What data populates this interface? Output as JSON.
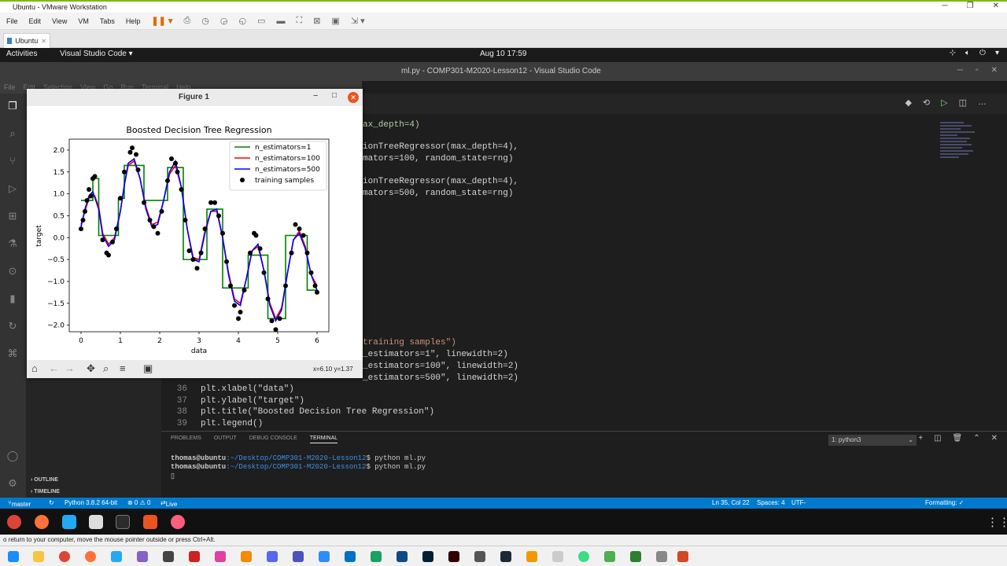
{
  "vmware": {
    "title": "Ubuntu - VMware Workstation",
    "menu": [
      "File",
      "Edit",
      "View",
      "VM",
      "Tabs",
      "Help"
    ],
    "tab_label": "Ubuntu",
    "hint": "o return to your computer, move the mouse pointer outside or press Ctrl+Alt."
  },
  "gnome": {
    "activities": "Activities",
    "app_label": "Visual Studio Code",
    "clock": "Aug 10  17:59"
  },
  "vscode": {
    "window_title": "ml.py - COMP301-M2020-Lesson12 - Visual Studio Code",
    "menu": [
      "File",
      "Edit",
      "Selection",
      "View",
      "Go",
      "Run",
      "Terminal",
      "Help"
    ],
    "sidebar_outline": "OUTLINE",
    "sidebar_timeline": "TIMELINE",
    "code_partial": [
      "ax_depth=4)",
      "ionTreeRegressor(max_depth=4),",
      "mators=100, random_state=rng)",
      "ionTreeRegressor(max_depth=4),",
      "mators=500, random_state=rng)",
      "training samples\")",
      "_estimators=1\", linewidth=2)",
      "_estimators=100\", linewidth=2)",
      "_estimators=500\", linewidth=2)"
    ],
    "code_lines": [
      {
        "num": "36",
        "text": "plt.xlabel(\"data\")"
      },
      {
        "num": "37",
        "text": "plt.ylabel(\"target\")"
      },
      {
        "num": "38",
        "text": "plt.title(\"Boosted Decision Tree Regression\")"
      },
      {
        "num": "39",
        "text": "plt.legend()"
      }
    ],
    "panel_tabs": [
      "PROBLEMS",
      "OUTPUT",
      "DEBUG CONSOLE",
      "TERMINAL"
    ],
    "terminal_select": "1: python3",
    "terminal_lines": [
      {
        "user": "thomas@ubuntu",
        "path": ":~/Desktop/COMP301-M2020-Lesson12",
        "cmd": "$ python ml.py"
      },
      {
        "user": "thomas@ubuntu",
        "path": ":~/Desktop/COMP301-M2020-Lesson12",
        "cmd": "$ python ml.py"
      }
    ],
    "status": {
      "branch": "master",
      "python": "Python 3.8.2 64-bit",
      "problems": "⊗ 0 ⚠ 0",
      "liveshare": "Live Share",
      "position": "Ln 35, Col 22",
      "spaces": "Spaces: 4",
      "encoding": "UTF-",
      "formatting": "Formatting: ✓"
    }
  },
  "figure": {
    "window_title": "Figure 1",
    "coord_readout": "x=6.10 y=1.37",
    "colors": {
      "n1": "#008000",
      "n100": "#ff0000",
      "n500": "#0000ff",
      "samples": "#000000"
    }
  },
  "chart_data": {
    "type": "line",
    "title": "Boosted Decision Tree Regression",
    "xlabel": "data",
    "ylabel": "target",
    "xlim": [
      -0.3,
      6.3
    ],
    "ylim": [
      -2.15,
      2.25
    ],
    "xticks": [
      0,
      1,
      2,
      3,
      4,
      5,
      6
    ],
    "yticks": [
      -2.0,
      -1.5,
      -1.0,
      -0.5,
      0.0,
      0.5,
      1.0,
      1.5,
      2.0
    ],
    "legend_position": "top-right",
    "legend": [
      "n_estimators=1",
      "n_estimators=100",
      "n_estimators=500",
      "training samples"
    ],
    "training_samples": [
      [
        0.0,
        0.2
      ],
      [
        0.05,
        0.4
      ],
      [
        0.15,
        0.85
      ],
      [
        0.2,
        1.1
      ],
      [
        0.3,
        1.35
      ],
      [
        0.35,
        1.4
      ],
      [
        0.25,
        0.95
      ],
      [
        0.1,
        0.6
      ],
      [
        0.55,
        -0.05
      ],
      [
        0.65,
        -0.35
      ],
      [
        0.7,
        -0.4
      ],
      [
        0.8,
        -0.1
      ],
      [
        0.9,
        0.2
      ],
      [
        1.0,
        0.9
      ],
      [
        1.1,
        1.5
      ],
      [
        1.25,
        1.95
      ],
      [
        1.3,
        2.05
      ],
      [
        1.4,
        1.9
      ],
      [
        1.45,
        1.55
      ],
      [
        1.6,
        0.8
      ],
      [
        1.75,
        0.4
      ],
      [
        1.85,
        0.25
      ],
      [
        1.95,
        0.1
      ],
      [
        2.05,
        0.6
      ],
      [
        2.2,
        1.3
      ],
      [
        2.3,
        1.8
      ],
      [
        2.4,
        1.7
      ],
      [
        2.45,
        1.5
      ],
      [
        2.55,
        1.1
      ],
      [
        2.65,
        0.4
      ],
      [
        2.75,
        -0.3
      ],
      [
        2.85,
        -0.5
      ],
      [
        2.95,
        -0.7
      ],
      [
        3.05,
        -0.35
      ],
      [
        3.15,
        0.2
      ],
      [
        3.3,
        0.8
      ],
      [
        3.4,
        0.8
      ],
      [
        3.5,
        0.5
      ],
      [
        3.6,
        0.1
      ],
      [
        3.7,
        -0.55
      ],
      [
        3.8,
        -1.1
      ],
      [
        3.9,
        -1.55
      ],
      [
        4.0,
        -1.85
      ],
      [
        4.05,
        -1.7
      ],
      [
        4.15,
        -1.2
      ],
      [
        4.3,
        -0.35
      ],
      [
        4.4,
        0.1
      ],
      [
        4.45,
        0.05
      ],
      [
        4.55,
        -0.25
      ],
      [
        4.65,
        -0.8
      ],
      [
        4.75,
        -1.4
      ],
      [
        4.85,
        -1.9
      ],
      [
        4.95,
        -2.1
      ],
      [
        5.05,
        -1.85
      ],
      [
        5.2,
        -1.1
      ],
      [
        5.35,
        -0.35
      ],
      [
        5.45,
        0.3
      ],
      [
        5.55,
        0.2
      ],
      [
        5.65,
        0.05
      ],
      [
        5.75,
        -0.35
      ],
      [
        5.85,
        -0.8
      ],
      [
        5.95,
        -1.1
      ],
      [
        6.0,
        -1.25
      ]
    ],
    "series_n1": [
      [
        0.0,
        0.85
      ],
      [
        0.3,
        0.85
      ],
      [
        0.3,
        1.35
      ],
      [
        0.45,
        1.35
      ],
      [
        0.45,
        0.05
      ],
      [
        0.95,
        0.05
      ],
      [
        0.95,
        0.9
      ],
      [
        1.1,
        0.9
      ],
      [
        1.1,
        1.65
      ],
      [
        1.6,
        1.65
      ],
      [
        1.6,
        0.85
      ],
      [
        2.2,
        0.85
      ],
      [
        2.2,
        1.6
      ],
      [
        2.6,
        1.6
      ],
      [
        2.6,
        -0.5
      ],
      [
        3.2,
        -0.5
      ],
      [
        3.2,
        0.65
      ],
      [
        3.6,
        0.65
      ],
      [
        3.6,
        -1.15
      ],
      [
        4.25,
        -1.15
      ],
      [
        4.25,
        -0.4
      ],
      [
        4.75,
        -0.4
      ],
      [
        4.75,
        -1.85
      ],
      [
        5.2,
        -1.85
      ],
      [
        5.2,
        0.05
      ],
      [
        5.75,
        0.05
      ],
      [
        5.75,
        -1.2
      ],
      [
        6.0,
        -1.2
      ]
    ],
    "series_n100": [
      [
        0.0,
        0.3
      ],
      [
        0.1,
        0.6
      ],
      [
        0.2,
        0.9
      ],
      [
        0.35,
        0.95
      ],
      [
        0.45,
        0.7
      ],
      [
        0.55,
        0.1
      ],
      [
        0.7,
        -0.15
      ],
      [
        0.85,
        0.0
      ],
      [
        1.0,
        0.6
      ],
      [
        1.1,
        1.2
      ],
      [
        1.2,
        1.65
      ],
      [
        1.35,
        1.75
      ],
      [
        1.5,
        1.35
      ],
      [
        1.65,
        0.7
      ],
      [
        1.8,
        0.3
      ],
      [
        1.95,
        0.35
      ],
      [
        2.1,
        0.85
      ],
      [
        2.25,
        1.45
      ],
      [
        2.4,
        1.65
      ],
      [
        2.55,
        1.15
      ],
      [
        2.7,
        0.2
      ],
      [
        2.85,
        -0.45
      ],
      [
        3.0,
        -0.5
      ],
      [
        3.15,
        0.15
      ],
      [
        3.3,
        0.6
      ],
      [
        3.45,
        0.6
      ],
      [
        3.6,
        0.0
      ],
      [
        3.75,
        -0.8
      ],
      [
        3.9,
        -1.4
      ],
      [
        4.05,
        -1.5
      ],
      [
        4.2,
        -0.95
      ],
      [
        4.35,
        -0.3
      ],
      [
        4.5,
        -0.2
      ],
      [
        4.65,
        -0.75
      ],
      [
        4.8,
        -1.5
      ],
      [
        4.95,
        -1.85
      ],
      [
        5.1,
        -1.6
      ],
      [
        5.25,
        -0.8
      ],
      [
        5.4,
        -0.05
      ],
      [
        5.55,
        0.15
      ],
      [
        5.7,
        -0.2
      ],
      [
        5.85,
        -0.85
      ],
      [
        6.0,
        -1.1
      ]
    ],
    "series_n500": [
      [
        0.0,
        0.25
      ],
      [
        0.1,
        0.65
      ],
      [
        0.2,
        0.95
      ],
      [
        0.3,
        1.05
      ],
      [
        0.45,
        0.65
      ],
      [
        0.55,
        0.05
      ],
      [
        0.7,
        -0.2
      ],
      [
        0.85,
        -0.05
      ],
      [
        1.0,
        0.6
      ],
      [
        1.1,
        1.2
      ],
      [
        1.2,
        1.7
      ],
      [
        1.35,
        1.8
      ],
      [
        1.5,
        1.35
      ],
      [
        1.65,
        0.65
      ],
      [
        1.8,
        0.25
      ],
      [
        1.95,
        0.3
      ],
      [
        2.1,
        0.85
      ],
      [
        2.25,
        1.5
      ],
      [
        2.4,
        1.75
      ],
      [
        2.55,
        1.15
      ],
      [
        2.7,
        0.2
      ],
      [
        2.85,
        -0.5
      ],
      [
        3.0,
        -0.55
      ],
      [
        3.15,
        0.1
      ],
      [
        3.3,
        0.6
      ],
      [
        3.45,
        0.65
      ],
      [
        3.6,
        0.0
      ],
      [
        3.75,
        -0.85
      ],
      [
        3.9,
        -1.45
      ],
      [
        4.05,
        -1.55
      ],
      [
        4.2,
        -0.95
      ],
      [
        4.35,
        -0.3
      ],
      [
        4.5,
        -0.15
      ],
      [
        4.65,
        -0.75
      ],
      [
        4.8,
        -1.55
      ],
      [
        4.95,
        -1.9
      ],
      [
        5.1,
        -1.65
      ],
      [
        5.25,
        -0.8
      ],
      [
        5.4,
        -0.05
      ],
      [
        5.55,
        0.1
      ],
      [
        5.7,
        -0.25
      ],
      [
        5.85,
        -0.85
      ],
      [
        6.0,
        -1.2
      ]
    ]
  }
}
